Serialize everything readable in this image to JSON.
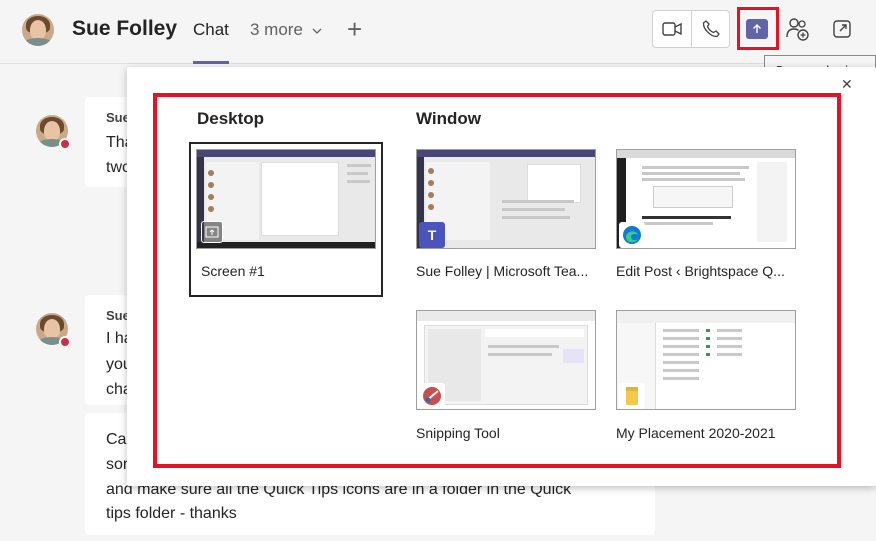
{
  "header": {
    "name": "Sue Folley",
    "tab_chat": "Chat",
    "more_tabs": "3 more",
    "add_tab": "+"
  },
  "tooltip": "Screen sharing",
  "messages": [
    {
      "author": "Sue",
      "lines": [
        "Tha",
        "two"
      ]
    },
    {
      "author": "Sue",
      "lines": [
        "I ha",
        "you",
        "cha"
      ]
    },
    {
      "lines": [
        "Car",
        "sor",
        "and make sure all the Quick Tips icons are in a folder in the Quick",
        "tips folder - thanks"
      ]
    }
  ],
  "share_panel": {
    "desktop_title": "Desktop",
    "window_title": "Window",
    "desktop_tiles": [
      {
        "label": "Screen #1"
      }
    ],
    "window_tiles": [
      {
        "label": "Sue Folley | Microsoft Tea..."
      },
      {
        "label": "Edit Post ‹ Brightspace Q..."
      },
      {
        "label": "Snipping Tool"
      },
      {
        "label": "My Placement 2020-2021"
      }
    ]
  },
  "colors": {
    "accent": "#6264a7",
    "highlight": "#e81123",
    "presence_busy": "#c4314b"
  }
}
